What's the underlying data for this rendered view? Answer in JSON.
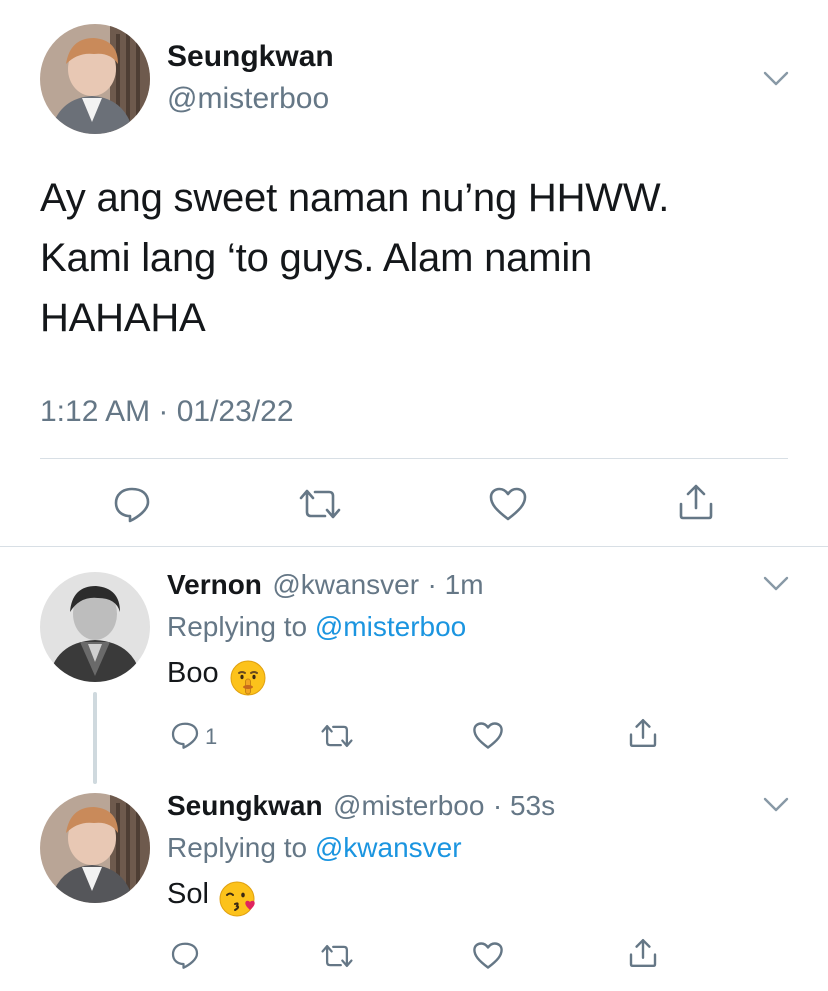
{
  "main_tweet": {
    "author_name": "Seungkwan",
    "author_handle": "@misterboo",
    "text_lines": [
      "Ay ang sweet naman nu’ng HHWW.",
      "Kami lang ‘to guys. Alam namin",
      "HAHAHA"
    ],
    "timestamp": "1:12 AM · 01/23/22",
    "actions": [
      "reply-icon",
      "retweet-icon",
      "like-icon",
      "share-icon"
    ]
  },
  "replies": [
    {
      "author_name": "Vernon",
      "author_handle": "@kwansver",
      "time": "· 1m",
      "replying_label": "Replying to",
      "replying_to": "@misterboo",
      "text": "Boo",
      "emoji": "shushing-face-emoji",
      "reply_count": "1"
    },
    {
      "author_name": "Seungkwan",
      "author_handle": "@misterboo",
      "time": "· 53s",
      "replying_label": "Replying to",
      "replying_to": "@kwansver",
      "text": "Sol",
      "emoji": "face-blowing-kiss-emoji",
      "reply_count": ""
    }
  ],
  "colors": {
    "text": "#14171a",
    "secondary": "#657786",
    "link": "#1b95e0",
    "divider": "#d8dfe5",
    "icon": "#657786"
  }
}
